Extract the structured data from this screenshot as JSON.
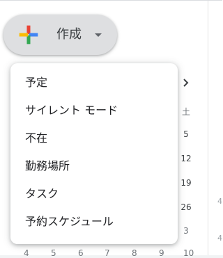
{
  "create_button": {
    "label": "作成",
    "icon": "colorful-plus-icon",
    "caret_icon": "caret-down-icon"
  },
  "mini_calendar": {
    "next_icon": "chevron-right-icon",
    "saturday_header": "土",
    "saturday_dates": [
      "5",
      "12",
      "19",
      "26",
      "3"
    ],
    "bottom_row": [
      "4",
      "5",
      "6",
      "7",
      "8",
      "9",
      "10"
    ],
    "edge_marks": [
      "4",
      "4"
    ]
  },
  "menu": {
    "items": [
      {
        "label": "予定"
      },
      {
        "label": "サイレント モード"
      },
      {
        "label": "不在"
      },
      {
        "label": "勤務場所"
      },
      {
        "label": "タスク"
      },
      {
        "label": "予約スケジュール"
      }
    ]
  },
  "colors": {
    "blue": "#4285f4",
    "red": "#ea4335",
    "yellow": "#fbbc04",
    "green": "#34a853",
    "button_bg": "#dedfe1"
  }
}
